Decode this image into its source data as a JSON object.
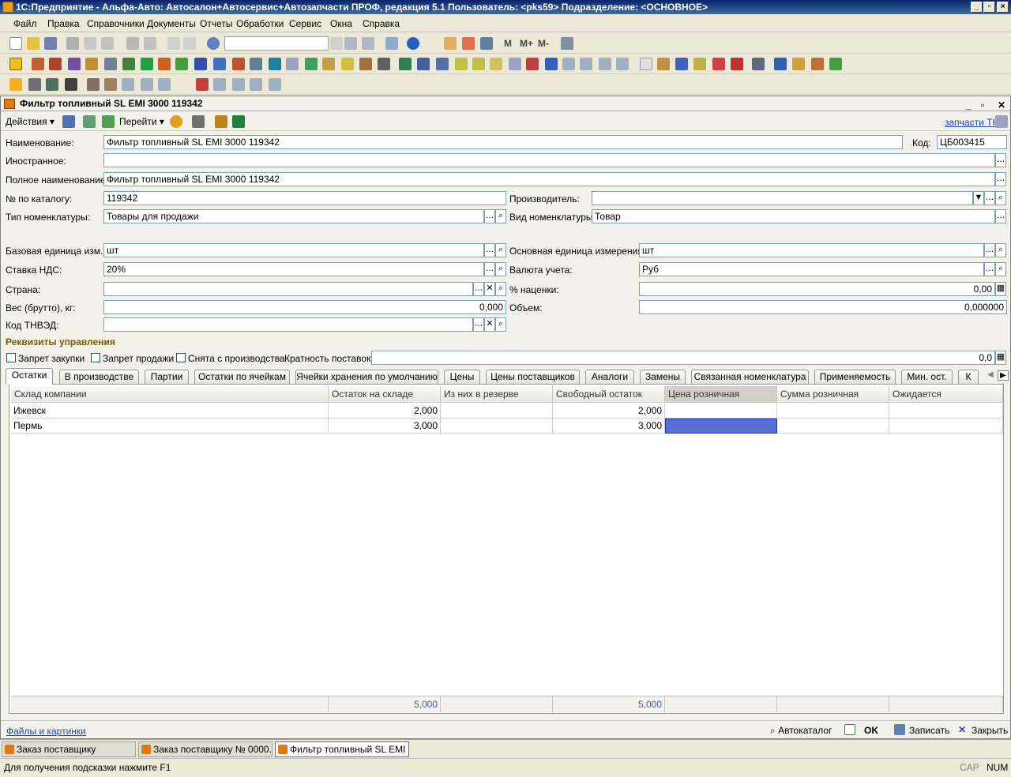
{
  "window": {
    "title": "1С:Предприятие - Альфа-Авто: Автосалон+Автосервис+Автозапчасти ПРОФ, редакция 5.1    Пользователь: <pks59>    Подразделение: <ОСНОВНОЕ>"
  },
  "menu": [
    "Файл",
    "Правка",
    "Справочники",
    "Документы",
    "Отчеты",
    "Обработки",
    "Сервис",
    "Окна",
    "Справка"
  ],
  "toolbar": {
    "m": "M",
    "mplus": "M+",
    "mminus": "M-"
  },
  "doc": {
    "title": "Фильтр топливный SL EMI 3000 119342",
    "actions": "Действия",
    "goto": "Перейти",
    "link_right": "запчасти ТК"
  },
  "form": {
    "name_label": "Наименование:",
    "name_value": "Фильтр топливный SL EMI 3000 119342",
    "code_label": "Код:",
    "code_value": "ЦБ003415",
    "foreign_label": "Иностранное:",
    "foreign_value": "",
    "fullname_label": "Полное наименование:",
    "fullname_value": "Фильтр топливный SL EMI 3000 119342",
    "catalog_label": "№ по каталогу:",
    "catalog_value": "119342",
    "manufacturer_label": "Производитель:",
    "manufacturer_value": "",
    "type_label": "Тип номенклатуры:",
    "type_value": "Товары  для продажи",
    "kind_label": "Вид номенклатуры:",
    "kind_value": "Товар",
    "base_unit_label": "Базовая единица изм...",
    "base_unit_value": "шт",
    "main_unit_label": "Основная единица измерения:",
    "main_unit_value": "шт",
    "vat_label": "Ставка НДС:",
    "vat_value": "20%",
    "currency_label": "Валюта учета:",
    "currency_value": "Руб",
    "country_label": "Страна:",
    "country_value": "",
    "markup_label": "% наценки:",
    "markup_value": "0,00",
    "weight_label": "Вес (брутто), кг:",
    "weight_value": "0,000",
    "volume_label": "Объем:",
    "volume_value": "0,000000",
    "tnved_label": "Код ТНВЭД:",
    "tnved_value": "",
    "section_title": "Реквизиты управления",
    "chk_purchase": "Запрет закупки",
    "chk_sale": "Запрет продажи",
    "chk_discontinued": "Снята с производства",
    "multiplicity_label": "Кратность поставок:",
    "multiplicity_value": "0,0"
  },
  "tabs": [
    "Остатки",
    "В производстве",
    "Партии",
    "Остатки по ячейкам",
    "Ячейки хранения по умолчанию",
    "Цены",
    "Цены поставщиков",
    "Аналоги",
    "Замены",
    "Связанная номенклатура",
    "Применяемость",
    "Мин. ост.",
    "К"
  ],
  "grid": {
    "columns": [
      "Склад компании",
      "Остаток на складе",
      "Из них в резерве",
      "Свободный остаток",
      "Цена розничная",
      "Сумма розничная",
      "Ожидается"
    ],
    "rows": [
      [
        "Ижевск",
        "2,000",
        "",
        "2,000",
        "",
        "",
        ""
      ],
      [
        "Пермь",
        "3,000",
        "",
        "3,000",
        "",
        "",
        ""
      ]
    ],
    "totals": [
      "",
      "5,000",
      "",
      "5,000",
      "",
      "",
      ""
    ]
  },
  "bottom": {
    "files_link": "Файлы и картинки",
    "autocatalog": "Автокаталог",
    "ok": "OK",
    "save": "Записать",
    "close": "Закрыть"
  },
  "taskbar": [
    "Заказ поставщику",
    "Заказ поставщику № 0000...",
    "Фильтр топливный SL EMI ..."
  ],
  "status": {
    "hint": "Для получения подсказки нажмите F1",
    "cap": "CAP",
    "num": "NUM"
  },
  "colors": {
    "selected_cell": "#5a6fd6",
    "section": "#7a5a00",
    "link": "#1a4bb0"
  }
}
